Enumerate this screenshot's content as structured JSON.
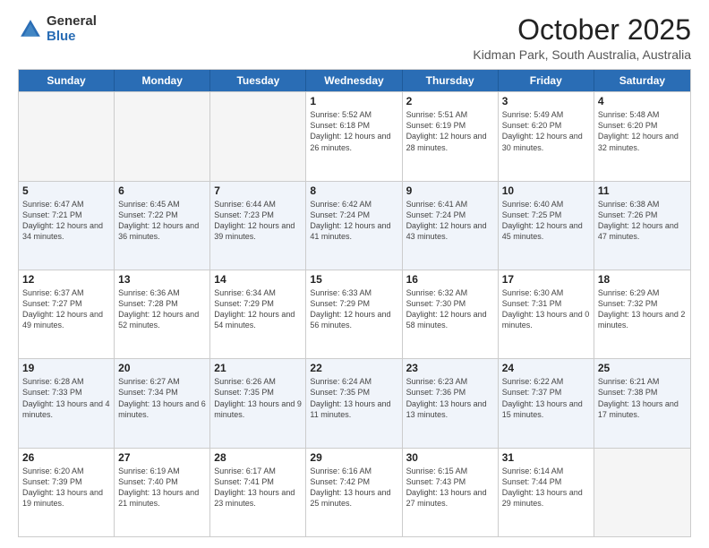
{
  "logo": {
    "general": "General",
    "blue": "Blue"
  },
  "header": {
    "month": "October 2025",
    "location": "Kidman Park, South Australia, Australia"
  },
  "days": [
    "Sunday",
    "Monday",
    "Tuesday",
    "Wednesday",
    "Thursday",
    "Friday",
    "Saturday"
  ],
  "rows": [
    [
      {
        "day": "",
        "text": ""
      },
      {
        "day": "",
        "text": ""
      },
      {
        "day": "",
        "text": ""
      },
      {
        "day": "1",
        "text": "Sunrise: 5:52 AM\nSunset: 6:18 PM\nDaylight: 12 hours\nand 26 minutes."
      },
      {
        "day": "2",
        "text": "Sunrise: 5:51 AM\nSunset: 6:19 PM\nDaylight: 12 hours\nand 28 minutes."
      },
      {
        "day": "3",
        "text": "Sunrise: 5:49 AM\nSunset: 6:20 PM\nDaylight: 12 hours\nand 30 minutes."
      },
      {
        "day": "4",
        "text": "Sunrise: 5:48 AM\nSunset: 6:20 PM\nDaylight: 12 hours\nand 32 minutes."
      }
    ],
    [
      {
        "day": "5",
        "text": "Sunrise: 6:47 AM\nSunset: 7:21 PM\nDaylight: 12 hours\nand 34 minutes."
      },
      {
        "day": "6",
        "text": "Sunrise: 6:45 AM\nSunset: 7:22 PM\nDaylight: 12 hours\nand 36 minutes."
      },
      {
        "day": "7",
        "text": "Sunrise: 6:44 AM\nSunset: 7:23 PM\nDaylight: 12 hours\nand 39 minutes."
      },
      {
        "day": "8",
        "text": "Sunrise: 6:42 AM\nSunset: 7:24 PM\nDaylight: 12 hours\nand 41 minutes."
      },
      {
        "day": "9",
        "text": "Sunrise: 6:41 AM\nSunset: 7:24 PM\nDaylight: 12 hours\nand 43 minutes."
      },
      {
        "day": "10",
        "text": "Sunrise: 6:40 AM\nSunset: 7:25 PM\nDaylight: 12 hours\nand 45 minutes."
      },
      {
        "day": "11",
        "text": "Sunrise: 6:38 AM\nSunset: 7:26 PM\nDaylight: 12 hours\nand 47 minutes."
      }
    ],
    [
      {
        "day": "12",
        "text": "Sunrise: 6:37 AM\nSunset: 7:27 PM\nDaylight: 12 hours\nand 49 minutes."
      },
      {
        "day": "13",
        "text": "Sunrise: 6:36 AM\nSunset: 7:28 PM\nDaylight: 12 hours\nand 52 minutes."
      },
      {
        "day": "14",
        "text": "Sunrise: 6:34 AM\nSunset: 7:29 PM\nDaylight: 12 hours\nand 54 minutes."
      },
      {
        "day": "15",
        "text": "Sunrise: 6:33 AM\nSunset: 7:29 PM\nDaylight: 12 hours\nand 56 minutes."
      },
      {
        "day": "16",
        "text": "Sunrise: 6:32 AM\nSunset: 7:30 PM\nDaylight: 12 hours\nand 58 minutes."
      },
      {
        "day": "17",
        "text": "Sunrise: 6:30 AM\nSunset: 7:31 PM\nDaylight: 13 hours\nand 0 minutes."
      },
      {
        "day": "18",
        "text": "Sunrise: 6:29 AM\nSunset: 7:32 PM\nDaylight: 13 hours\nand 2 minutes."
      }
    ],
    [
      {
        "day": "19",
        "text": "Sunrise: 6:28 AM\nSunset: 7:33 PM\nDaylight: 13 hours\nand 4 minutes."
      },
      {
        "day": "20",
        "text": "Sunrise: 6:27 AM\nSunset: 7:34 PM\nDaylight: 13 hours\nand 6 minutes."
      },
      {
        "day": "21",
        "text": "Sunrise: 6:26 AM\nSunset: 7:35 PM\nDaylight: 13 hours\nand 9 minutes."
      },
      {
        "day": "22",
        "text": "Sunrise: 6:24 AM\nSunset: 7:35 PM\nDaylight: 13 hours\nand 11 minutes."
      },
      {
        "day": "23",
        "text": "Sunrise: 6:23 AM\nSunset: 7:36 PM\nDaylight: 13 hours\nand 13 minutes."
      },
      {
        "day": "24",
        "text": "Sunrise: 6:22 AM\nSunset: 7:37 PM\nDaylight: 13 hours\nand 15 minutes."
      },
      {
        "day": "25",
        "text": "Sunrise: 6:21 AM\nSunset: 7:38 PM\nDaylight: 13 hours\nand 17 minutes."
      }
    ],
    [
      {
        "day": "26",
        "text": "Sunrise: 6:20 AM\nSunset: 7:39 PM\nDaylight: 13 hours\nand 19 minutes."
      },
      {
        "day": "27",
        "text": "Sunrise: 6:19 AM\nSunset: 7:40 PM\nDaylight: 13 hours\nand 21 minutes."
      },
      {
        "day": "28",
        "text": "Sunrise: 6:17 AM\nSunset: 7:41 PM\nDaylight: 13 hours\nand 23 minutes."
      },
      {
        "day": "29",
        "text": "Sunrise: 6:16 AM\nSunset: 7:42 PM\nDaylight: 13 hours\nand 25 minutes."
      },
      {
        "day": "30",
        "text": "Sunrise: 6:15 AM\nSunset: 7:43 PM\nDaylight: 13 hours\nand 27 minutes."
      },
      {
        "day": "31",
        "text": "Sunrise: 6:14 AM\nSunset: 7:44 PM\nDaylight: 13 hours\nand 29 minutes."
      },
      {
        "day": "",
        "text": ""
      }
    ]
  ],
  "row_alt": [
    false,
    true,
    false,
    true,
    false
  ]
}
